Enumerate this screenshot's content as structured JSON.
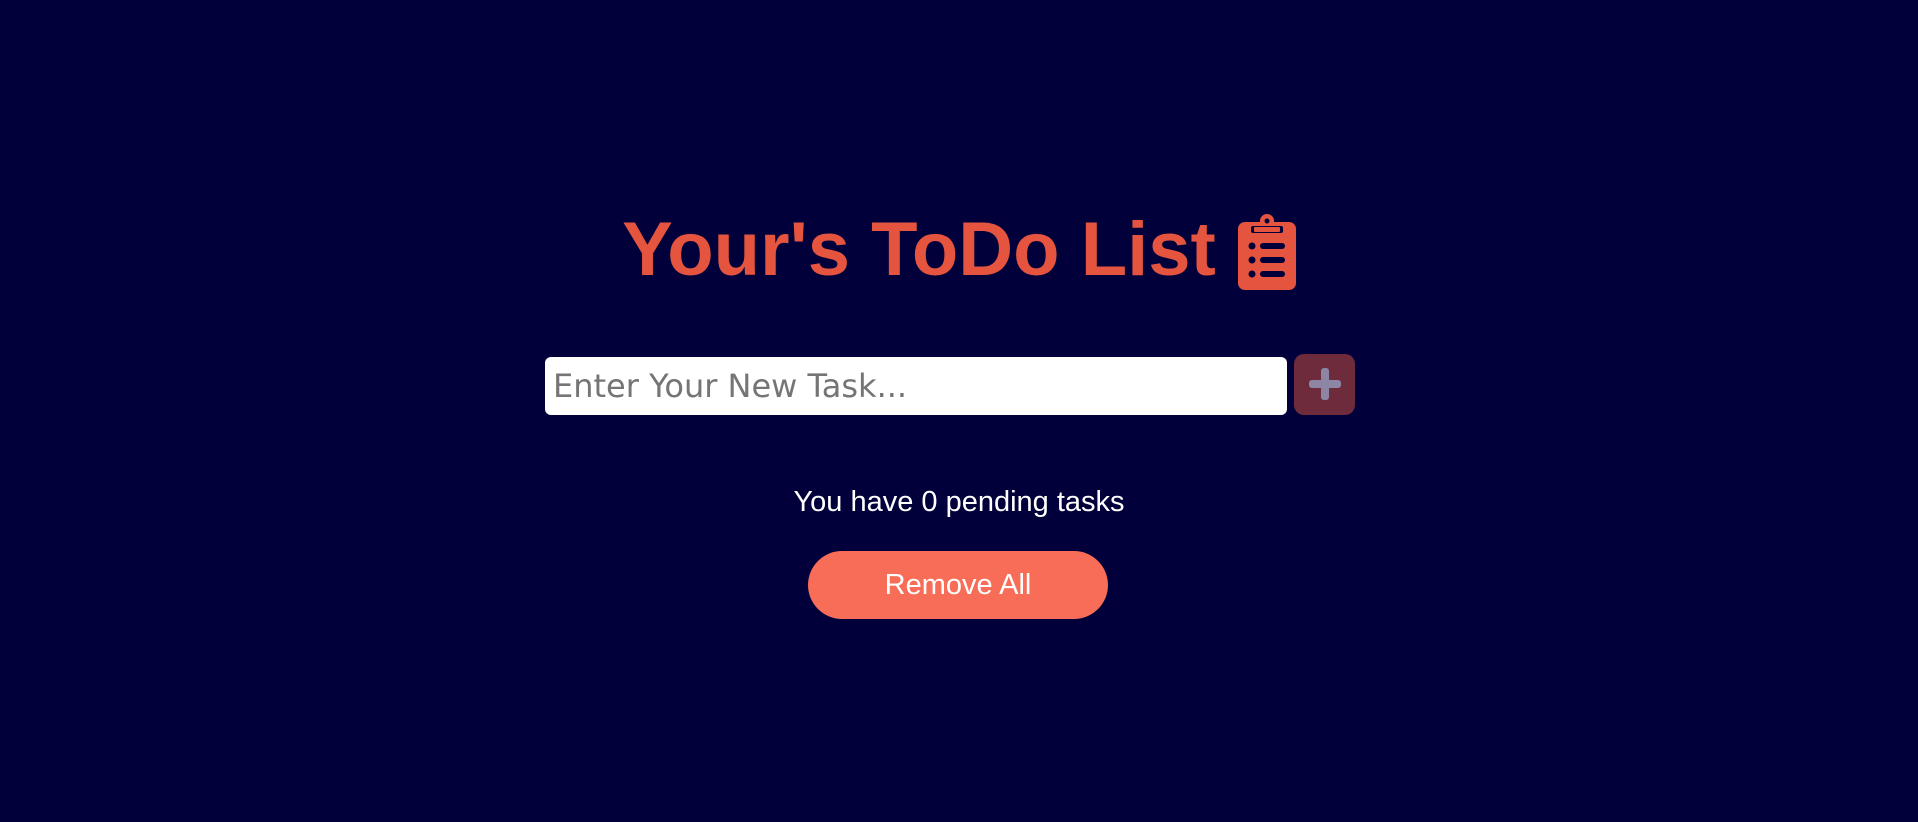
{
  "header": {
    "title": "Your's ToDo List",
    "icon": "clipboard-list-icon"
  },
  "task_form": {
    "input_value": "",
    "input_placeholder": "Enter Your New Task...",
    "add_button_icon": "plus-icon"
  },
  "footer": {
    "pending_text": "You have 0 pending tasks",
    "remove_all_label": "Remove All"
  },
  "colors": {
    "background": "#01003a",
    "accent": "#e4543e",
    "button": "#f76d57",
    "add_button": "#6e2b3c"
  }
}
